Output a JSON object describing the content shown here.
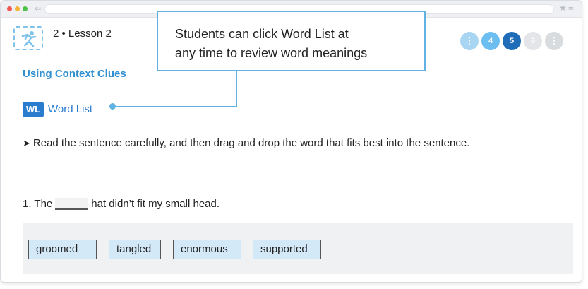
{
  "header": {
    "lesson_title": "2 • Lesson 2",
    "nav_steps": [
      {
        "label": "⋮"
      },
      {
        "label": "4"
      },
      {
        "label": "5"
      },
      {
        "label": "6"
      },
      {
        "label": "⋮"
      }
    ]
  },
  "callout": {
    "line1": "Students can click Word List at",
    "line2": "any time to review word meanings"
  },
  "content": {
    "section_title": "Using Context Clues",
    "word_list_badge": "WL",
    "word_list_label": "Word List",
    "instruction": "Read the sentence carefully, and then drag and drop the word that fits best into the sentence.",
    "question_prefix": "1. The",
    "question_suffix": "hat didn’t fit my small head."
  },
  "word_bank": {
    "words": [
      "groomed",
      "tangled",
      "enormous",
      "supported"
    ]
  },
  "colors": {
    "accent": "#2a7ccf",
    "callout_border": "#62b1e3",
    "current_step": "#1f6db8"
  }
}
